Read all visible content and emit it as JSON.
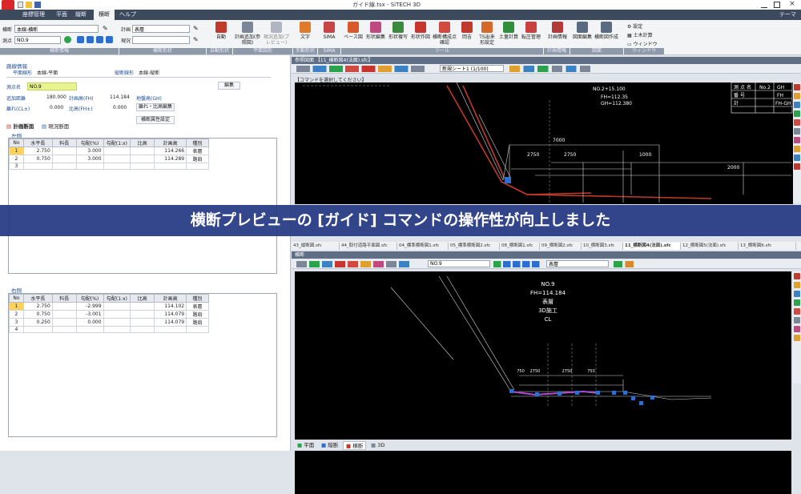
{
  "window": {
    "title": "ガイド線.tsx - SiTECH 3D",
    "theme_label": "テーマ"
  },
  "menu": {
    "items": [
      "座標管理",
      "平面",
      "縦断",
      "横断",
      "ヘルプ"
    ],
    "active_index": 3
  },
  "ribbon": {
    "row1_label": "横断",
    "row1_value": "本線-横断",
    "row2_label": "測点",
    "row2_value": "NO.9",
    "plan_label": "計画",
    "plan_value": "表層",
    "status_label": "現況",
    "status_value": "",
    "buttons": [
      "自動",
      "計画追加(参照図)",
      "現況追加(プレビュー)",
      "文字",
      "SIMA",
      "ベース図",
      "形状編集",
      "形状複写",
      "形状作図",
      "横断構成点確認",
      "岡吉",
      "TS出来形設定",
      "土量計算",
      "転圧管理",
      "計画情報",
      "図面編集",
      "横断図作成"
    ],
    "settings": [
      "設定",
      "土木計算",
      "ウィンドウ"
    ],
    "groups": [
      "横断情報",
      "横断形状",
      "自動形状",
      "平面図形",
      "手動形状",
      "SIMA",
      "ツール",
      "計画情報",
      "図面",
      "ウィンドウ"
    ]
  },
  "left": {
    "route_section": "路線情報",
    "plan_route_label": "平面線形",
    "plan_route_value": "本線-平面",
    "profile_route_label": "縦断線形",
    "profile_route_value": "本線-縦断",
    "station_name_label": "測点名",
    "station_name_value": "NO.9",
    "edit_button": "編集",
    "added_dist_label": "追加距離",
    "added_dist_value": "180.000",
    "fh_label": "計画高(FH)",
    "fh_value": "114.184",
    "gh_label": "地盤高(GH)",
    "gh_value": "",
    "cl_label": "離れ(CL±)",
    "cl_value": "0.000",
    "ratio_label": "比高(FH±)",
    "ratio_value": "0.000",
    "offset_edit_button": "離れ・比高編集",
    "attr_button": "横断属性設定",
    "tab_plan": "計画断面",
    "tab_current": "現況断面",
    "left_side": "左側",
    "right_side": "右側",
    "columns": [
      "No",
      "水平長",
      "料長",
      "勾配(%)",
      "勾配(1:x)",
      "比高",
      "計画高",
      "種別"
    ],
    "left_rows": [
      [
        "1",
        "2.750",
        "",
        "3.000",
        "",
        "",
        "114.266",
        "表層"
      ],
      [
        "2",
        "0.750",
        "",
        "3.000",
        "",
        "",
        "114.289",
        "路肩"
      ],
      [
        "3",
        "",
        "",
        "",
        "",
        "",
        "",
        ""
      ]
    ],
    "right_rows": [
      [
        "1",
        "2.750",
        "",
        "-2.999",
        "",
        "",
        "114.102",
        "表層"
      ],
      [
        "2",
        "0.750",
        "",
        "-3.001",
        "",
        "",
        "114.079",
        "路肩"
      ],
      [
        "3",
        "0.250",
        "",
        "0.000",
        "",
        "",
        "114.079",
        "路肩"
      ],
      [
        "4",
        "",
        "",
        "",
        "",
        "",
        "",
        ""
      ]
    ]
  },
  "right": {
    "ref_view_title": "参照図面 【11_横断図4(法面).sfc】",
    "command_prompt": "【コマンドを選択してください】",
    "sheet_select": "新規シート1 (1/100)",
    "ref_labels": {
      "station": "NO.2+15.100",
      "fh": "FH=112.35",
      "gh": "GH=112.380",
      "w1": "7000",
      "w2": "2750",
      "w3": "2750",
      "w4": "1000",
      "w5": "2000"
    },
    "table_labels": [
      "測",
      "点",
      "名",
      "No.2",
      "番",
      "号",
      "計",
      "GH",
      "FH",
      "FH-GH"
    ],
    "file_tabs": [
      "43_縦断図.sfc",
      "44_取付道路平面図.sfc",
      "04_標準横断図1.sfc",
      "05_標準横断図2.sfc",
      "08_横断図1.sfc",
      "09_横断図2.sfc",
      "10_横断図3.sfc",
      "11_横断図4(法面).sfc",
      "12_横断図5(法面).sfc",
      "13_横断図6.sfc"
    ],
    "active_file_tab": 7,
    "cross_view_title": "横断",
    "cross_station_select": "NO.9",
    "cross_layer_select": "表層",
    "cross_labels": {
      "station": "NO.9",
      "fh": "FH=114.184",
      "layer": "表層",
      "work": "3D施工",
      "cl": "CL",
      "d1": "750",
      "d2": "2750",
      "d3": "2750",
      "d4": "750"
    },
    "bottom_tabs": [
      "平面",
      "縦断",
      "横断",
      "3D"
    ],
    "active_bottom_tab": 2
  },
  "banner": {
    "text": "横断プレビューの [ガイド] コマンドの操作性が向上しました"
  }
}
